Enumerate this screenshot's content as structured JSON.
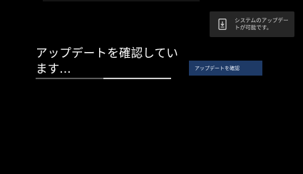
{
  "toast": {
    "icon": "phone-download-icon",
    "message": "システムのアップデートが可能です。"
  },
  "status": {
    "text": "アップデートを確認しています..."
  },
  "progress": {
    "fraction": 0.5
  },
  "button": {
    "label": "アップデートを確認"
  },
  "colors": {
    "background": "#000000",
    "toast_bg": "#262626",
    "button_bg": "#1e3a66",
    "progress_track": "#cfcfcf",
    "progress_fill": "#5a5a5a"
  }
}
